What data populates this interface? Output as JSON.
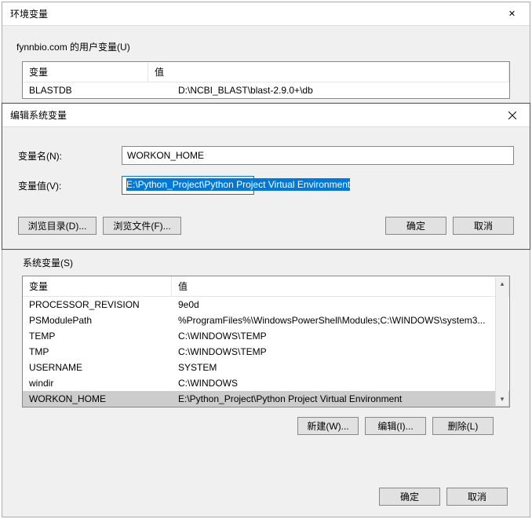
{
  "main_window": {
    "title": "环境变量",
    "user_vars_label": "fynnbio.com 的用户变量(U)",
    "headers": {
      "variable": "变量",
      "value": "值"
    },
    "user_rows": [
      {
        "variable": "BLASTDB",
        "value": "D:\\NCBI_BLAST\\blast-2.9.0+\\db"
      }
    ],
    "system_vars_label": "系统变量(S)",
    "system_rows": [
      {
        "variable": "PROCESSOR_REVISION",
        "value": "9e0d"
      },
      {
        "variable": "PSModulePath",
        "value": "%ProgramFiles%\\WindowsPowerShell\\Modules;C:\\WINDOWS\\system3..."
      },
      {
        "variable": "TEMP",
        "value": "C:\\WINDOWS\\TEMP"
      },
      {
        "variable": "TMP",
        "value": "C:\\WINDOWS\\TEMP"
      },
      {
        "variable": "USERNAME",
        "value": "SYSTEM"
      },
      {
        "variable": "windir",
        "value": "C:\\WINDOWS"
      },
      {
        "variable": "WORKON_HOME",
        "value": "E:\\Python_Project\\Python Project Virtual Environment"
      }
    ],
    "buttons": {
      "new": "新建(W)...",
      "edit": "编辑(I)...",
      "delete": "删除(L)",
      "ok": "确定",
      "cancel": "取消"
    }
  },
  "edit_dialog": {
    "title": "编辑系统变量",
    "name_label": "变量名(N):",
    "name_value": "WORKON_HOME",
    "value_label": "变量值(V):",
    "value_value": "E:\\Python_Project\\Python Project Virtual Environment",
    "buttons": {
      "browse_dir": "浏览目录(D)...",
      "browse_file": "浏览文件(F)...",
      "ok": "确定",
      "cancel": "取消"
    }
  }
}
